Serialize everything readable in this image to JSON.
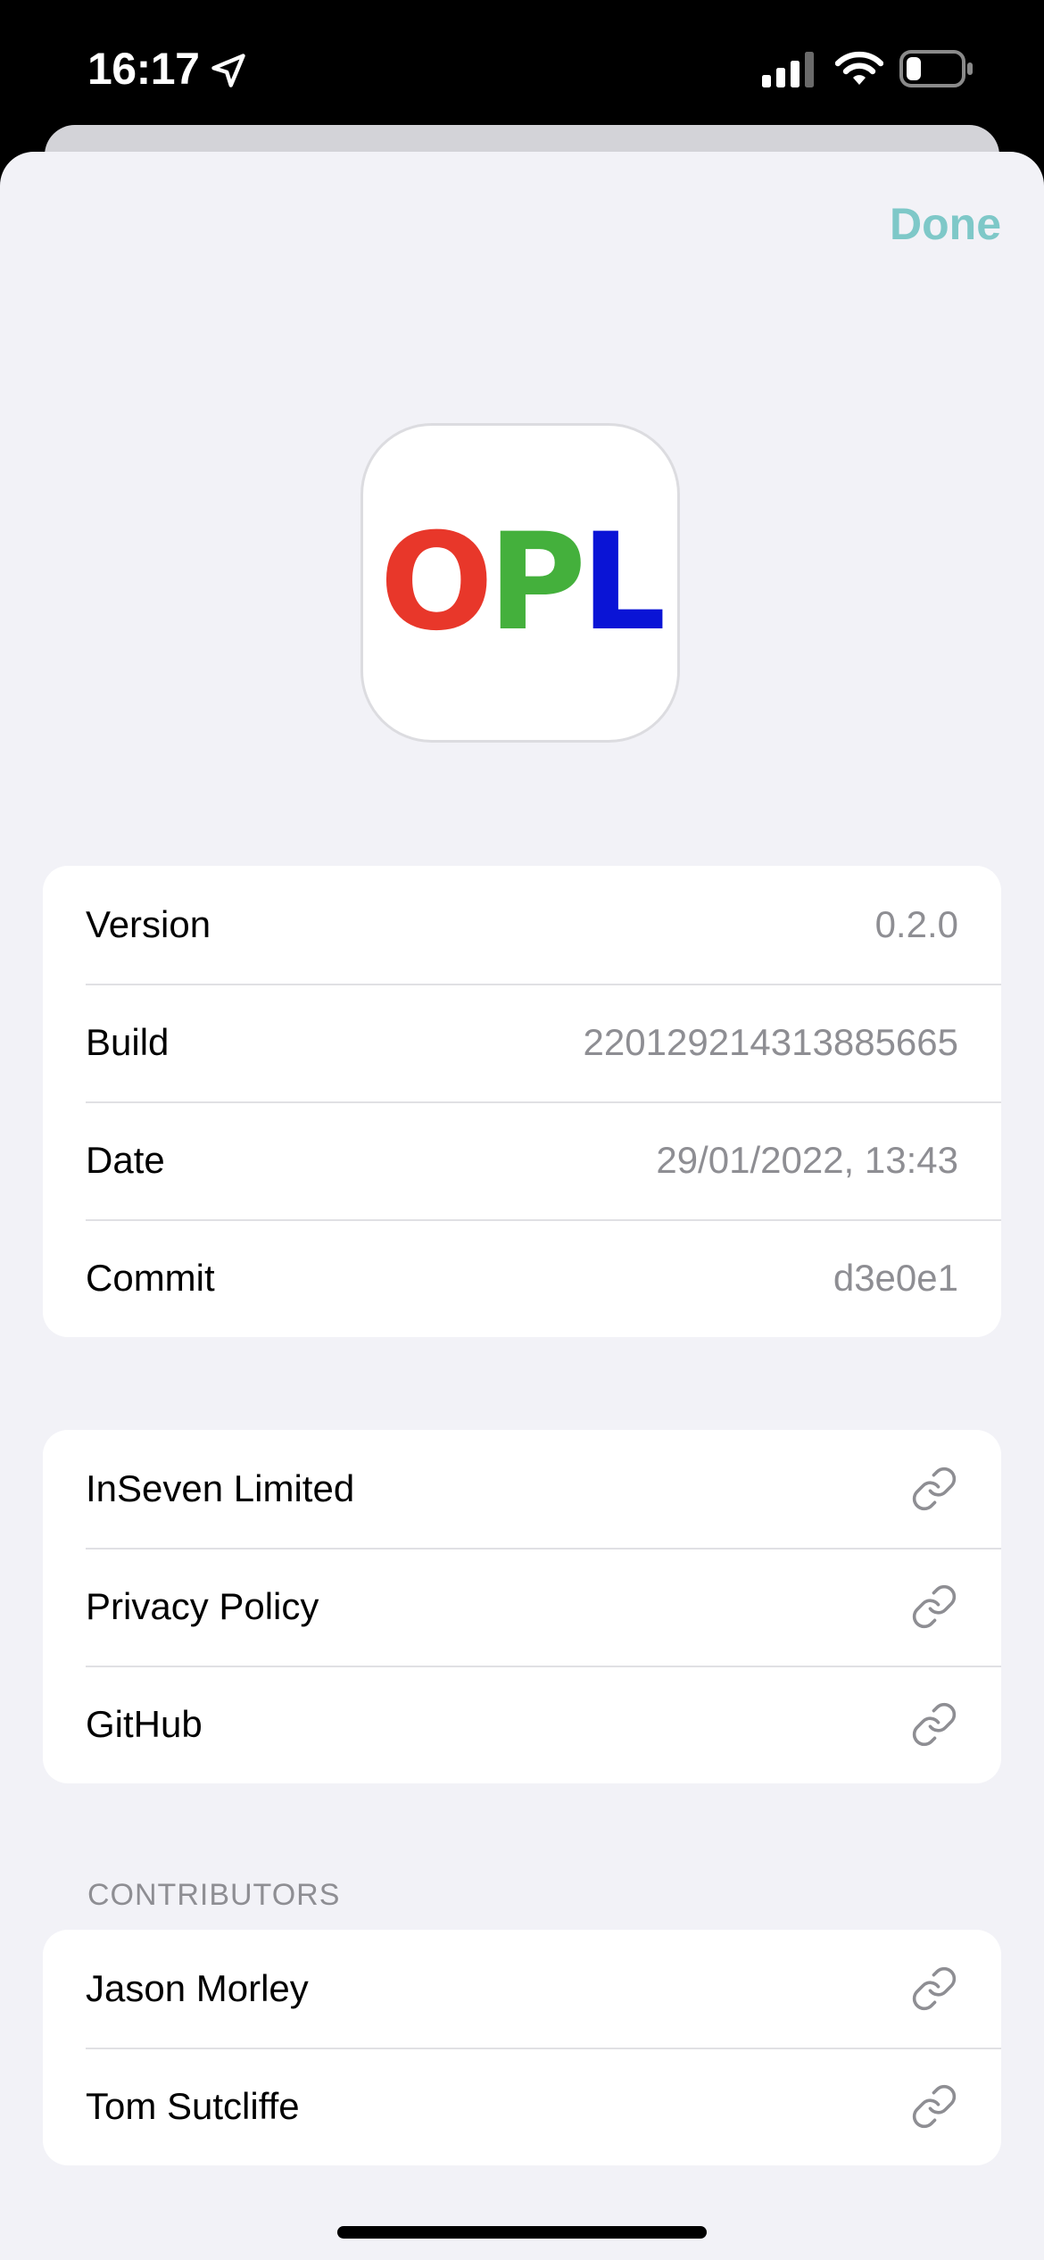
{
  "status_bar": {
    "time": "16:17",
    "icons": [
      "location-arrow-icon",
      "cellular-signal-icon",
      "wifi-icon",
      "battery-icon"
    ]
  },
  "header": {
    "done_label": "Done",
    "done_color": "#7ec8c8"
  },
  "app_icon": {
    "logo": [
      {
        "letter": "O",
        "color": "#e8372a"
      },
      {
        "letter": "P",
        "color": "#44b03c"
      },
      {
        "letter": "L",
        "color": "#0a14d6"
      }
    ]
  },
  "info": {
    "rows": [
      {
        "label": "Version",
        "value": "0.2.0"
      },
      {
        "label": "Build",
        "value": "220129214313885665"
      },
      {
        "label": "Date",
        "value": "29/01/2022, 13:43"
      },
      {
        "label": "Commit",
        "value": "d3e0e1"
      }
    ]
  },
  "links": {
    "rows": [
      {
        "label": "InSeven Limited",
        "icon": "link-icon"
      },
      {
        "label": "Privacy Policy",
        "icon": "link-icon"
      },
      {
        "label": "GitHub",
        "icon": "link-icon"
      }
    ]
  },
  "contributors": {
    "header": "CONTRIBUTORS",
    "rows": [
      {
        "label": "Jason Morley",
        "icon": "link-icon"
      },
      {
        "label": "Tom Sutcliffe",
        "icon": "link-icon"
      }
    ]
  }
}
